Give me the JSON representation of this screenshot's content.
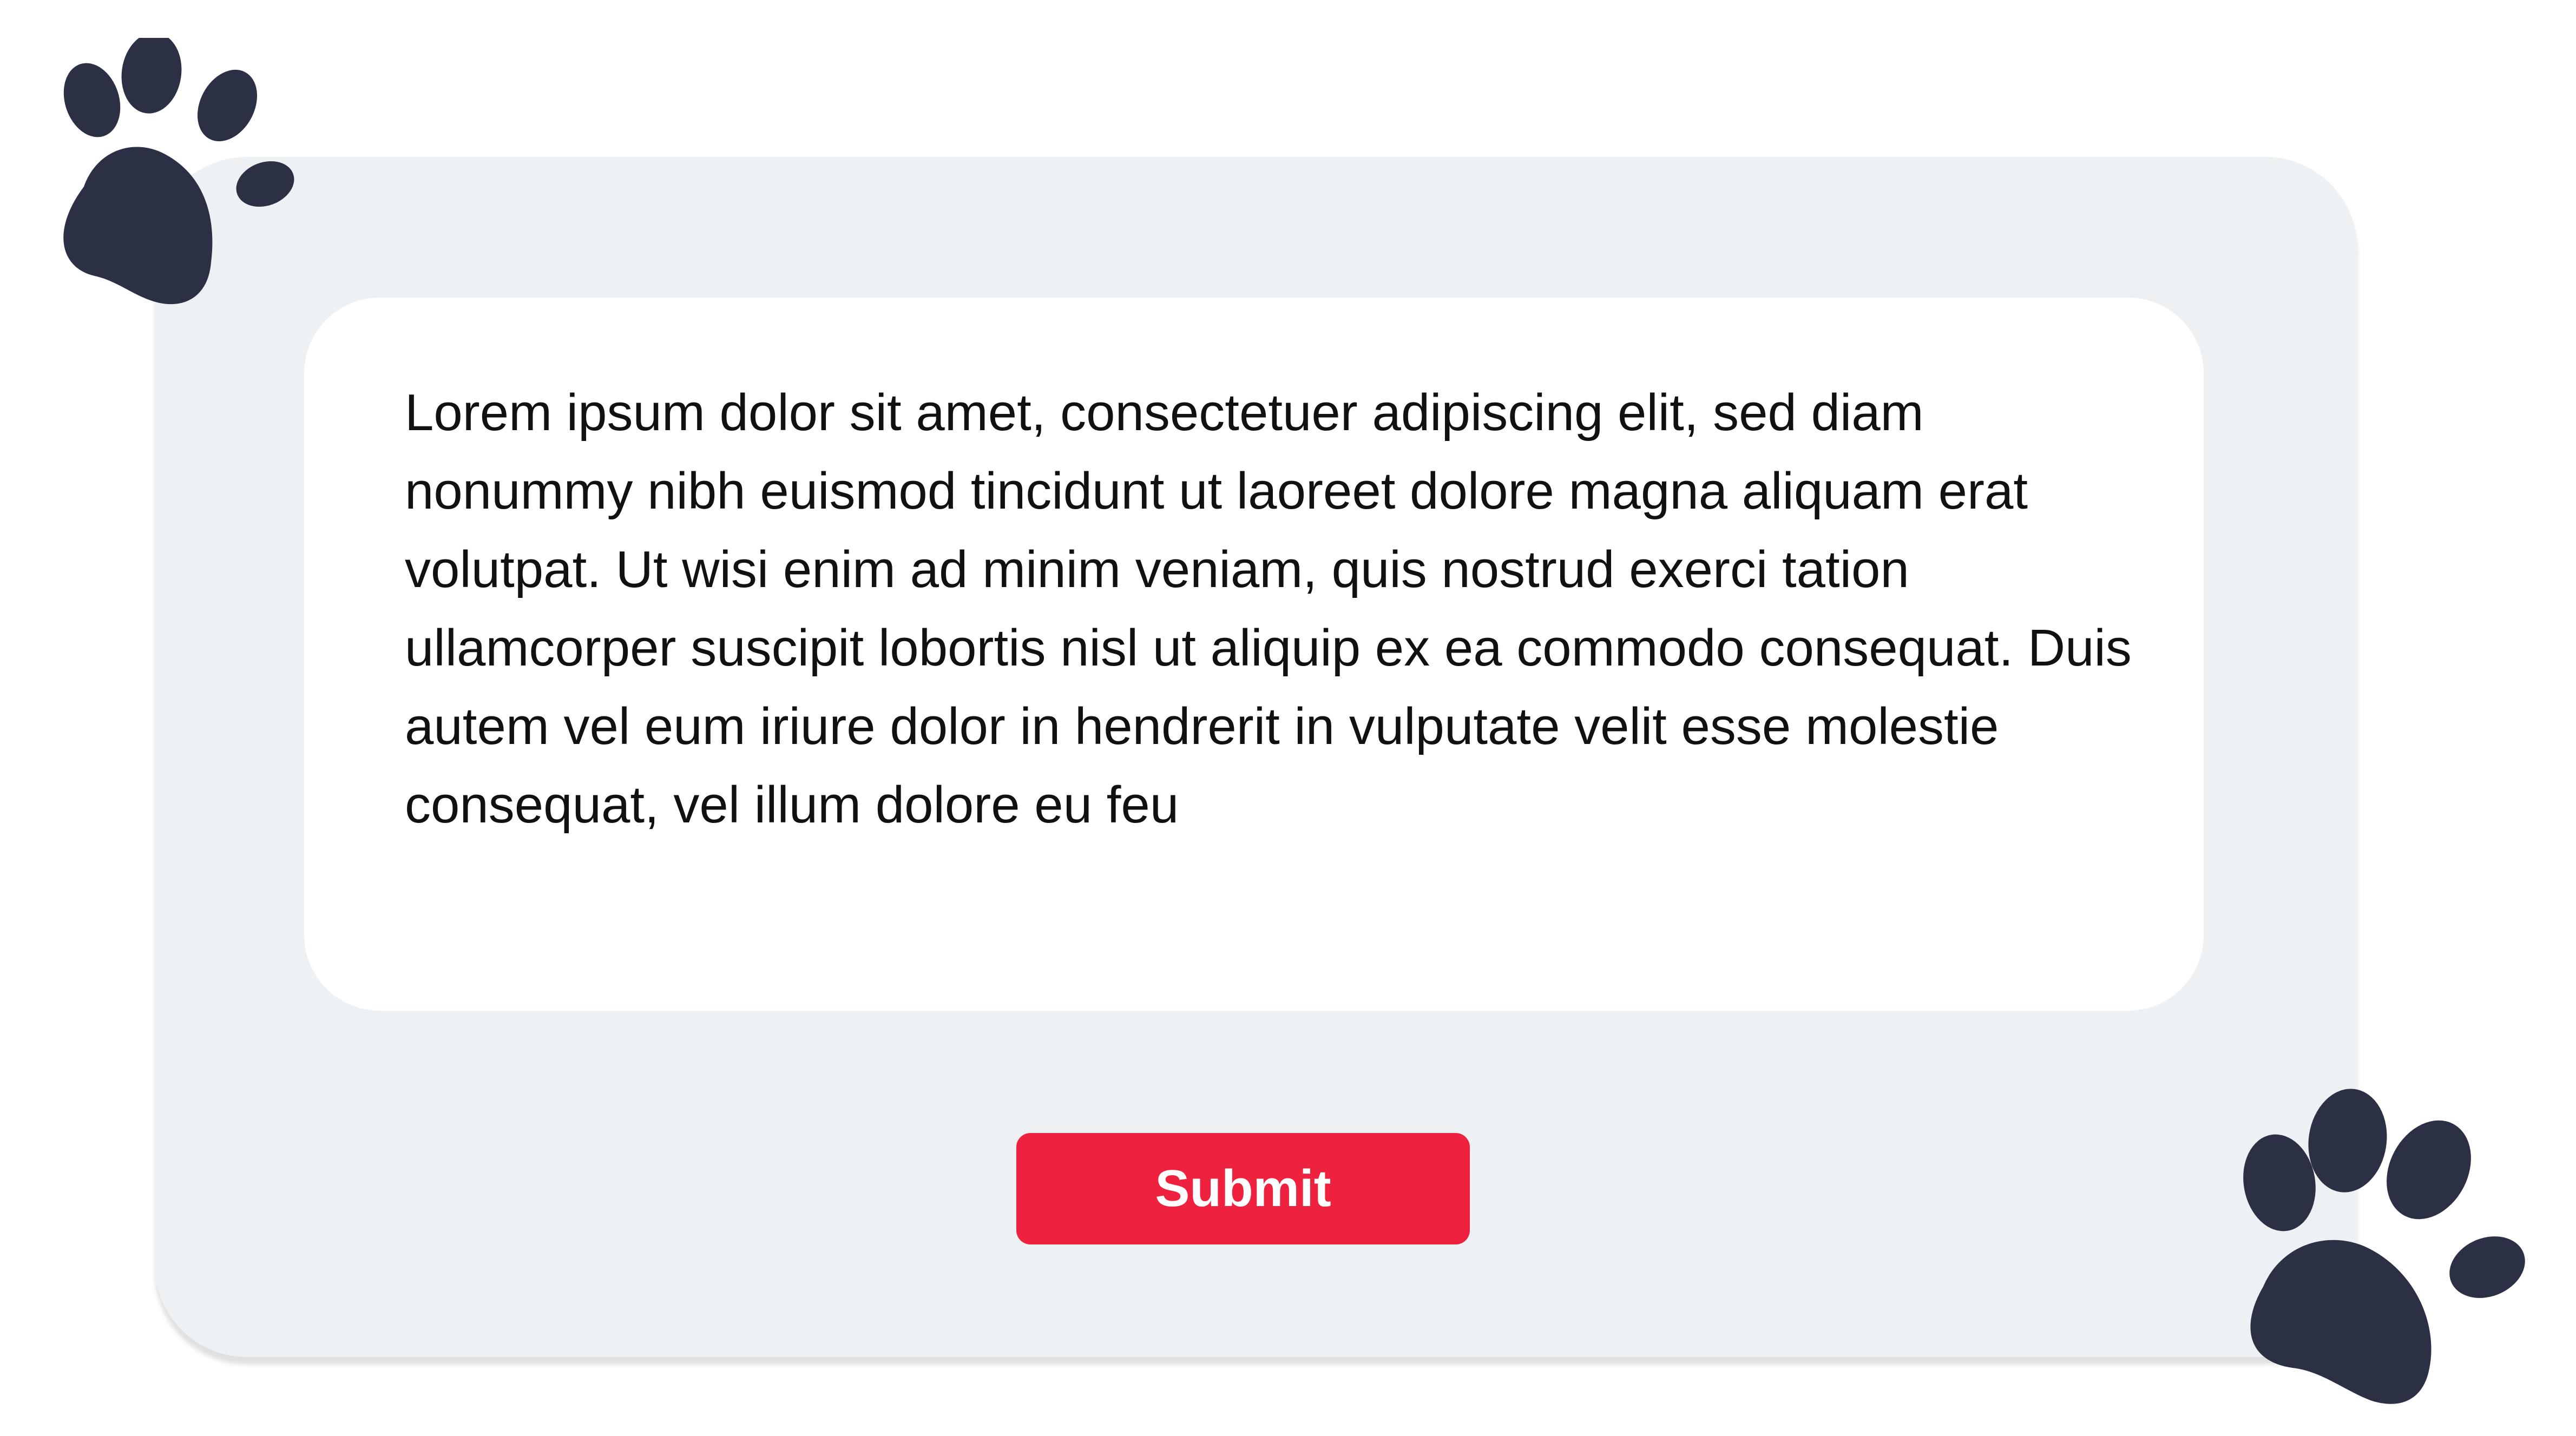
{
  "colors": {
    "background": "#ffffff",
    "card_background": "#edf1f4",
    "textbox_background": "#ffffff",
    "text": "#111111",
    "accent_button": "#ee223e",
    "paw": "#2c3044"
  },
  "icons": {
    "top_left": "paw-print-icon",
    "bottom_right": "paw-print-icon"
  },
  "message": {
    "body": "Lorem ipsum dolor sit amet, consectetuer adipiscing elit, sed diam nonummy nibh euismod tincidunt ut laoreet dolore magna aliquam erat volutpat. Ut wisi enim ad minim veniam, quis nostrud exerci tation ullamcorper suscipit lobortis nisl ut aliquip ex ea commodo consequat. Duis autem vel eum iriure dolor in hendrerit in vulputate velit esse molestie consequat, vel illum dolore eu feu"
  },
  "actions": {
    "submit_label": "Submit"
  }
}
